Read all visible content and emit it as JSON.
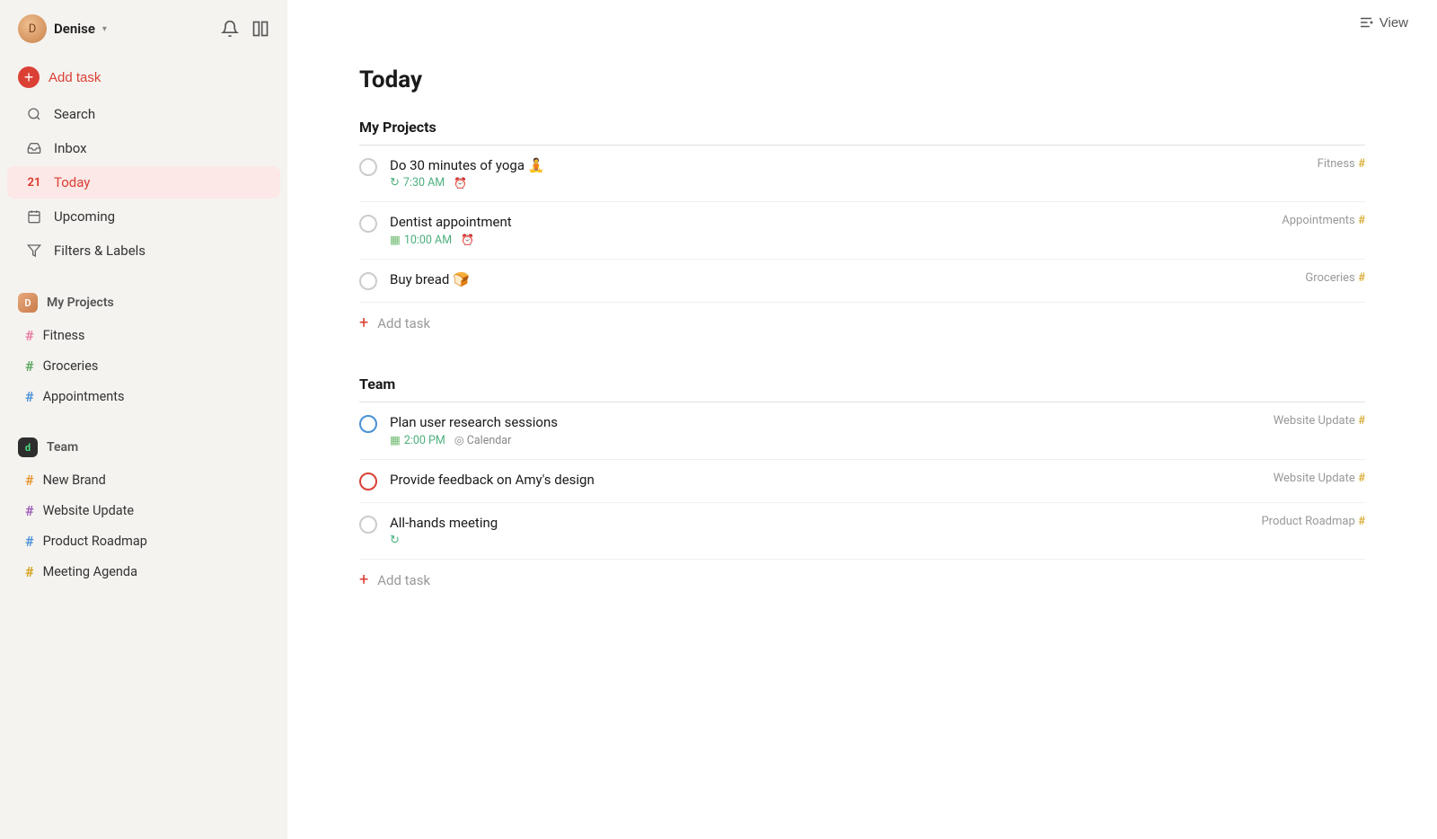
{
  "sidebar": {
    "user": {
      "name": "Denise",
      "chevron": "▾"
    },
    "nav": [
      {
        "id": "add-task",
        "label": "Add task",
        "icon": "+"
      },
      {
        "id": "search",
        "label": "Search",
        "icon": "🔍"
      },
      {
        "id": "inbox",
        "label": "Inbox",
        "icon": "📥"
      },
      {
        "id": "today",
        "label": "Today",
        "icon": "📅",
        "active": true
      },
      {
        "id": "upcoming",
        "label": "Upcoming",
        "icon": "📋"
      },
      {
        "id": "filters",
        "label": "Filters & Labels",
        "icon": "🏷"
      }
    ],
    "my_projects": {
      "label": "My Projects",
      "items": [
        {
          "id": "fitness",
          "label": "Fitness",
          "hash_color": "hash-pink"
        },
        {
          "id": "groceries",
          "label": "Groceries",
          "hash_color": "hash-green"
        },
        {
          "id": "appointments",
          "label": "Appointments",
          "hash_color": "hash-blue"
        }
      ]
    },
    "team": {
      "label": "Team",
      "items": [
        {
          "id": "new-brand",
          "label": "New Brand",
          "hash_color": "hash-orange"
        },
        {
          "id": "website-update",
          "label": "Website Update",
          "hash_color": "hash-purple"
        },
        {
          "id": "product-roadmap",
          "label": "Product Roadmap",
          "hash_color": "hash-blue"
        },
        {
          "id": "meeting-agenda",
          "label": "Meeting Agenda",
          "hash_color": "hash-gold"
        }
      ]
    }
  },
  "main": {
    "view_button": "View",
    "page_title": "Today",
    "my_projects_section": {
      "title": "My Projects",
      "tasks": [
        {
          "id": "yoga",
          "name": "Do 30 minutes of yoga 🧘",
          "time": "7:30 AM",
          "has_repeat": true,
          "has_alarm": true,
          "project": "Fitness",
          "check_style": "default"
        },
        {
          "id": "dentist",
          "name": "Dentist appointment",
          "time": "10:00 AM",
          "has_calendar": true,
          "has_alarm": true,
          "project": "Appointments",
          "check_style": "default"
        },
        {
          "id": "bread",
          "name": "Buy bread 🍞",
          "time": "",
          "project": "Groceries",
          "check_style": "default"
        }
      ],
      "add_task_label": "Add task"
    },
    "team_section": {
      "title": "Team",
      "tasks": [
        {
          "id": "user-research",
          "name": "Plan user research sessions",
          "time": "2:00 PM",
          "has_calendar": true,
          "location": "Calendar",
          "project": "Website Update",
          "check_style": "blue"
        },
        {
          "id": "feedback",
          "name": "Provide feedback on Amy's design",
          "time": "",
          "project": "Website Update",
          "check_style": "red"
        },
        {
          "id": "all-hands",
          "name": "All-hands meeting",
          "time": "",
          "has_repeat": true,
          "project": "Product Roadmap",
          "check_style": "default"
        }
      ],
      "add_task_label": "Add task"
    }
  }
}
